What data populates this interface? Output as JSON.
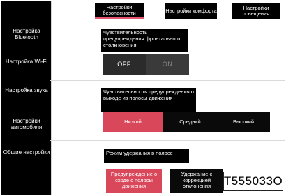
{
  "sidebar": {
    "items": [
      {
        "label": "Настройка Bluetooth"
      },
      {
        "label": "Настройка Wi-Fi"
      },
      {
        "label": "Настройка звука"
      },
      {
        "label": "Настройки автомобиля"
      },
      {
        "label": "Общие настройки"
      }
    ]
  },
  "tabs": [
    {
      "label": "Настройки безопасности",
      "active": true
    },
    {
      "label": "Настройки комфорта",
      "active": false
    },
    {
      "label": "Настройки освещения",
      "active": false
    }
  ],
  "settings": {
    "forward_warning": {
      "caption": "Чувствительность предупреждения фронтального столкновения",
      "options": [
        "OFF",
        "ON"
      ],
      "selected": "OFF"
    },
    "lane_departure": {
      "caption": "Чувствительность предупреждения о выходе из полосы движения",
      "options": [
        "Низкий",
        "Средний",
        "Высокий"
      ],
      "selected": "Низкий"
    },
    "lane_keeping": {
      "caption": "Режим удержания в полосе",
      "options": [
        "Предупреждение о сходе с полосы движения",
        "Удержание с коррекцией отклонения"
      ],
      "selected": "Предупреждение о сходе с полосы движения"
    }
  },
  "image_code": "T555033O",
  "colors": {
    "accent": "#d9475a",
    "background": "#000000"
  }
}
